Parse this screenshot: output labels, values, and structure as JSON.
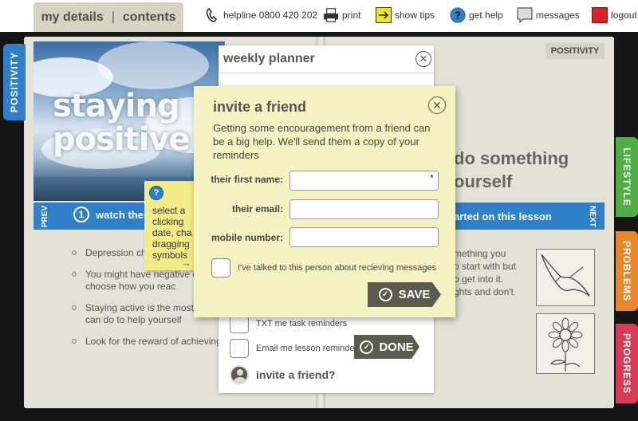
{
  "topbar": {
    "my_details": "my details",
    "separator": "|",
    "contents": "contents",
    "helpline": "helpline 0800 420 202",
    "print": "print",
    "show_tips": "show tips",
    "get_help": "get help",
    "messages": "messages",
    "logout": "logout"
  },
  "tabs": {
    "positivity": "POSITIVITY",
    "lifestyle": "LIFESTYLE",
    "problems": "PROBLEMS",
    "progress": "PROGRESS"
  },
  "colors": {
    "positivity": "#2f7fc9",
    "lifestyle": "#4fae44",
    "problems": "#e8882c",
    "progress": "#d63c58",
    "button": "#5a5a4e",
    "modal_bg": "#f5f2c2",
    "sticky_bg": "#f3ea88"
  },
  "lesson": {
    "hero_line1": "staying",
    "hero_line2": "positive",
    "section_label": "POSITIVITY",
    "prev": "PREV",
    "next": "NEXT",
    "step_number": "1",
    "watch_text": "watch the",
    "started_text": "arted on this lesson",
    "heading_line1": "do something",
    "heading_line2": "ourself",
    "bullets": [
      "Depression ch",
      "You might have negative can choose how you reac",
      "Staying active is the most you can do to help yourself",
      "Look for the reward of achieving"
    ],
    "right_text": [
      "mething you",
      "o start with but",
      "o get into it.",
      "ghts and don't"
    ]
  },
  "sticky_note": {
    "help_icon": "?",
    "lines": [
      "select a",
      "clicking",
      "date, cha",
      "dragging",
      "symbols"
    ],
    "arrow": "→"
  },
  "planner": {
    "title": "weekly planner",
    "txt_reminders": "TXT me task reminders",
    "email_reminder": "Email me lesson reminder",
    "done_label": "DONE",
    "invite_label": "invite a friend?"
  },
  "invite_modal": {
    "title": "invite a friend",
    "intro": "Getting some encouragement from a friend can be a big help. We'll send them a copy of your reminders",
    "first_name_label": "their first name:",
    "first_name_value": "",
    "required_marker": "*",
    "email_label": "their email:",
    "email_value": "",
    "mobile_label": "mobile number:",
    "mobile_value": "",
    "consent_label": "I've talked to this person about recieving messages",
    "save_label": "SAVE"
  }
}
